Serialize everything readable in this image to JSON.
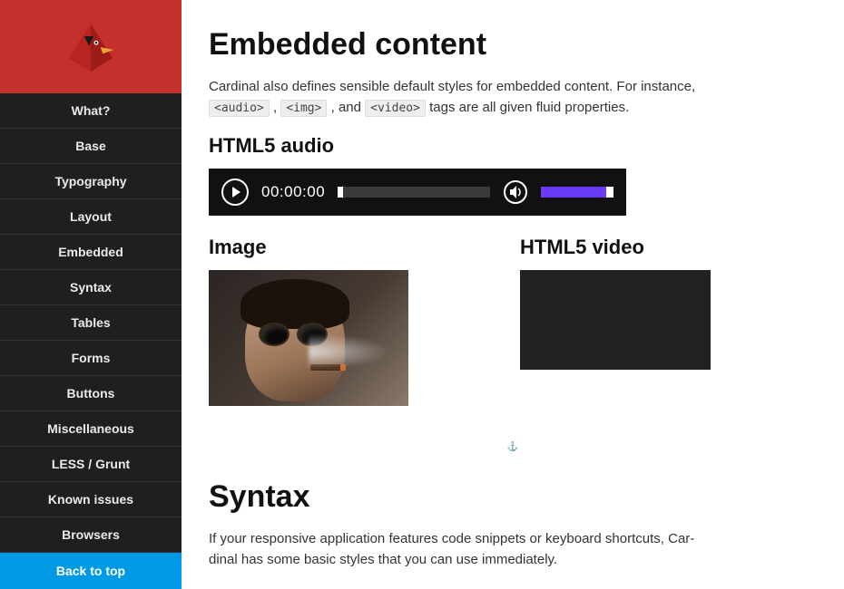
{
  "sidebar": {
    "items": [
      {
        "label": "What?"
      },
      {
        "label": "Base"
      },
      {
        "label": "Typography"
      },
      {
        "label": "Layout"
      },
      {
        "label": "Embedded"
      },
      {
        "label": "Syntax"
      },
      {
        "label": "Tables"
      },
      {
        "label": "Forms"
      },
      {
        "label": "Buttons"
      },
      {
        "label": "Miscellaneous"
      },
      {
        "label": "LESS / Grunt"
      },
      {
        "label": "Known issues"
      },
      {
        "label": "Browsers"
      }
    ],
    "back_label": "Back to top"
  },
  "embedded": {
    "title": "Embedded content",
    "intro_before": "Cardinal also defines sensible default styles for embedded content. For instance, ",
    "code1": "<audio>",
    "sep1": " , ",
    "code2": "<img>",
    "sep2": " , and ",
    "code3": "<video>",
    "intro_after": " tags are all given fluid properties.",
    "audio_heading": "HTML5 audio",
    "audio_time": "00:00:00",
    "image_heading": "Image",
    "video_heading": "HTML5 video"
  },
  "syntax": {
    "title": "Syntax",
    "intro": "If your responsive application features code snippets or keyboard shortcuts, Car­dinal has some basic styles that you can use immediately."
  }
}
